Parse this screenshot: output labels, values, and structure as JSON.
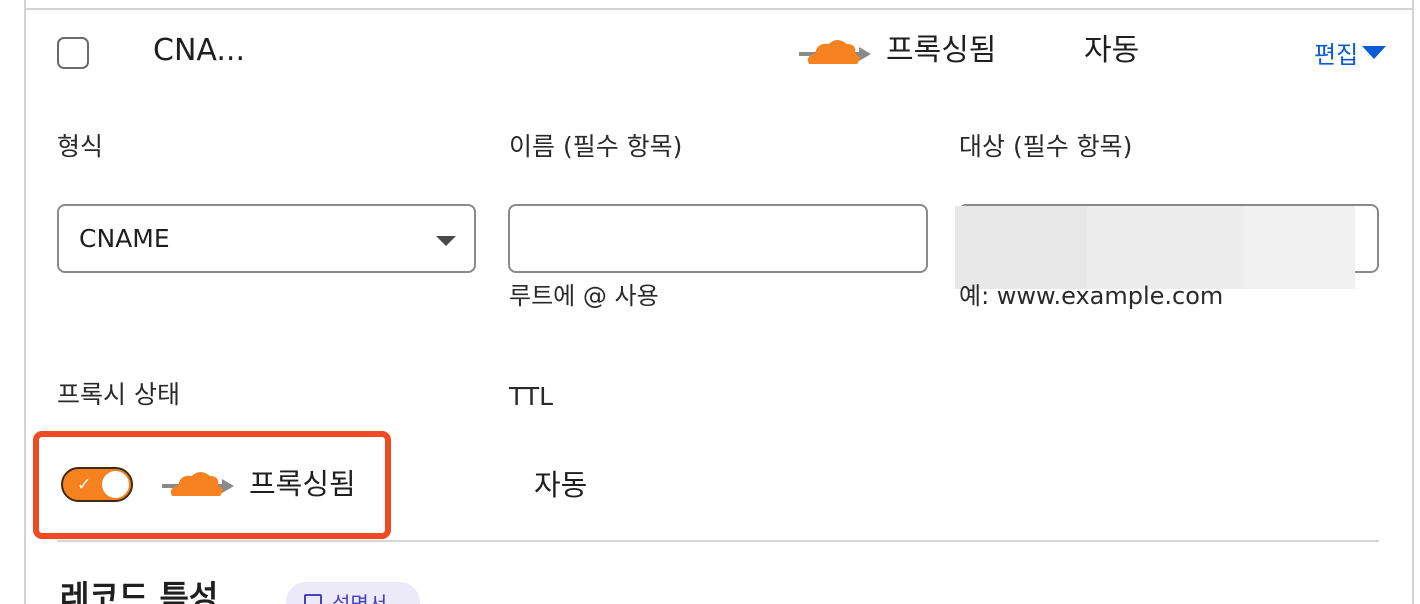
{
  "record_row": {
    "name": "CNA...",
    "proxy_status": "프록싱됨",
    "ttl": "자동",
    "edit_label": "편집"
  },
  "form": {
    "type_label": "형식",
    "type_value": "CNAME",
    "name_label": "이름 (필수 항목)",
    "name_value": "",
    "name_hint": "루트에 @ 사용",
    "target_label": "대상 (필수 항목)",
    "target_hint": "예: www.example.com",
    "proxy_label": "프록시 상태",
    "proxy_on": true,
    "proxy_value": "프록싱됨",
    "ttl_label": "TTL",
    "ttl_value": "자동"
  },
  "section": {
    "title": "레코드 특성",
    "doc_badge": "설명서"
  },
  "colors": {
    "cloud_orange": "#f6821f",
    "link_blue": "#0b5cd6",
    "highlight_red": "#f04a24"
  },
  "icons": [
    "cloud-proxy-icon",
    "chevron-down-icon",
    "check-icon",
    "book-icon"
  ]
}
